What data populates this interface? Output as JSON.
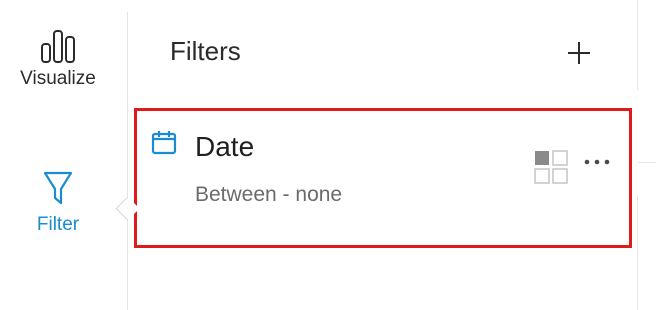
{
  "rail": {
    "visualize": {
      "label": "Visualize",
      "icon": "bar-chart-icon"
    },
    "filter": {
      "label": "Filter",
      "icon": "funnel-icon"
    }
  },
  "panel": {
    "title": "Filters",
    "add_icon": "plus-icon"
  },
  "filter_card": {
    "icon": "calendar-icon",
    "title": "Date",
    "subtitle": "Between - none",
    "layout_icon": "layout-grid-icon",
    "more_icon": "more-horizontal-icon"
  },
  "colors": {
    "accent": "#1a8ccf",
    "highlight_border": "#e01a1a",
    "text_primary": "#1f1f1f",
    "text_secondary": "#6b6b6b"
  }
}
